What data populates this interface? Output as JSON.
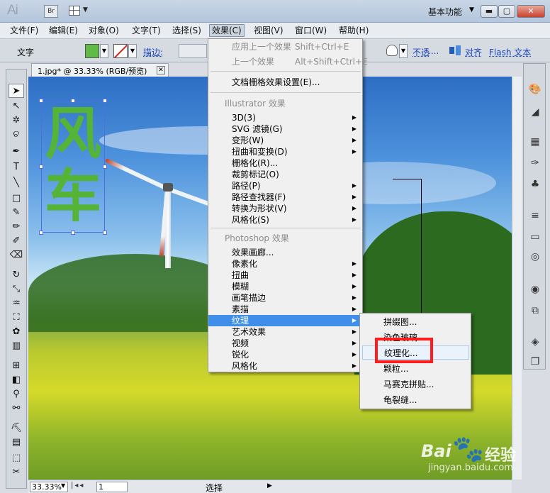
{
  "titlebar": {
    "app_logo": "Ai",
    "bridge_label": "Br",
    "workspace": "基本功能"
  },
  "menubar": {
    "items": [
      "文件(F)",
      "编辑(E)",
      "对象(O)",
      "文字(T)",
      "选择(S)",
      "效果(C)",
      "视图(V)",
      "窗口(W)",
      "帮助(H)"
    ]
  },
  "controlbar": {
    "mode_label": "文字",
    "stroke_label": "描边:",
    "opacity_label": "不透",
    "opacity_more": "....",
    "align_label": "对齐",
    "flash_label": "Flash 文本",
    "fill_color": "#5fba46",
    "stroke_color": "#d2231c"
  },
  "document": {
    "tab_label": "1.jpg* @ 33.33% (RGB/预览)",
    "selected_text": [
      "风",
      "车"
    ]
  },
  "effect_menu": {
    "apply_last": "应用上一个效果",
    "apply_last_shortcut": "Shift+Ctrl+E",
    "last_effect": "上一个效果",
    "last_effect_shortcut": "Alt+Shift+Ctrl+E",
    "raster_settings": "文档栅格效果设置(E)...",
    "illustrator_header": "Illustrator 效果",
    "illustrator_items": [
      "3D(3)",
      "SVG 滤镜(G)",
      "变形(W)",
      "扭曲和变换(D)",
      "栅格化(R)...",
      "裁剪标记(O)",
      "路径(P)",
      "路径查找器(F)",
      "转换为形状(V)",
      "风格化(S)"
    ],
    "photoshop_header": "Photoshop 效果",
    "photoshop_items": [
      "效果画廊...",
      "像素化",
      "扭曲",
      "模糊",
      "画笔描边",
      "素描",
      "纹理",
      "艺术效果",
      "视频",
      "锐化",
      "风格化"
    ]
  },
  "texture_menu": {
    "items": [
      "拼缀图...",
      "染色玻璃...",
      "纹理化...",
      "颗粒...",
      "马赛克拼贴...",
      "龟裂缝..."
    ]
  },
  "statusbar": {
    "zoom": "33.33%",
    "page": "1",
    "status": "选择"
  },
  "watermark": {
    "word1": "Bai",
    "word2": "经验",
    "url": "jingyan.baidu.com"
  }
}
